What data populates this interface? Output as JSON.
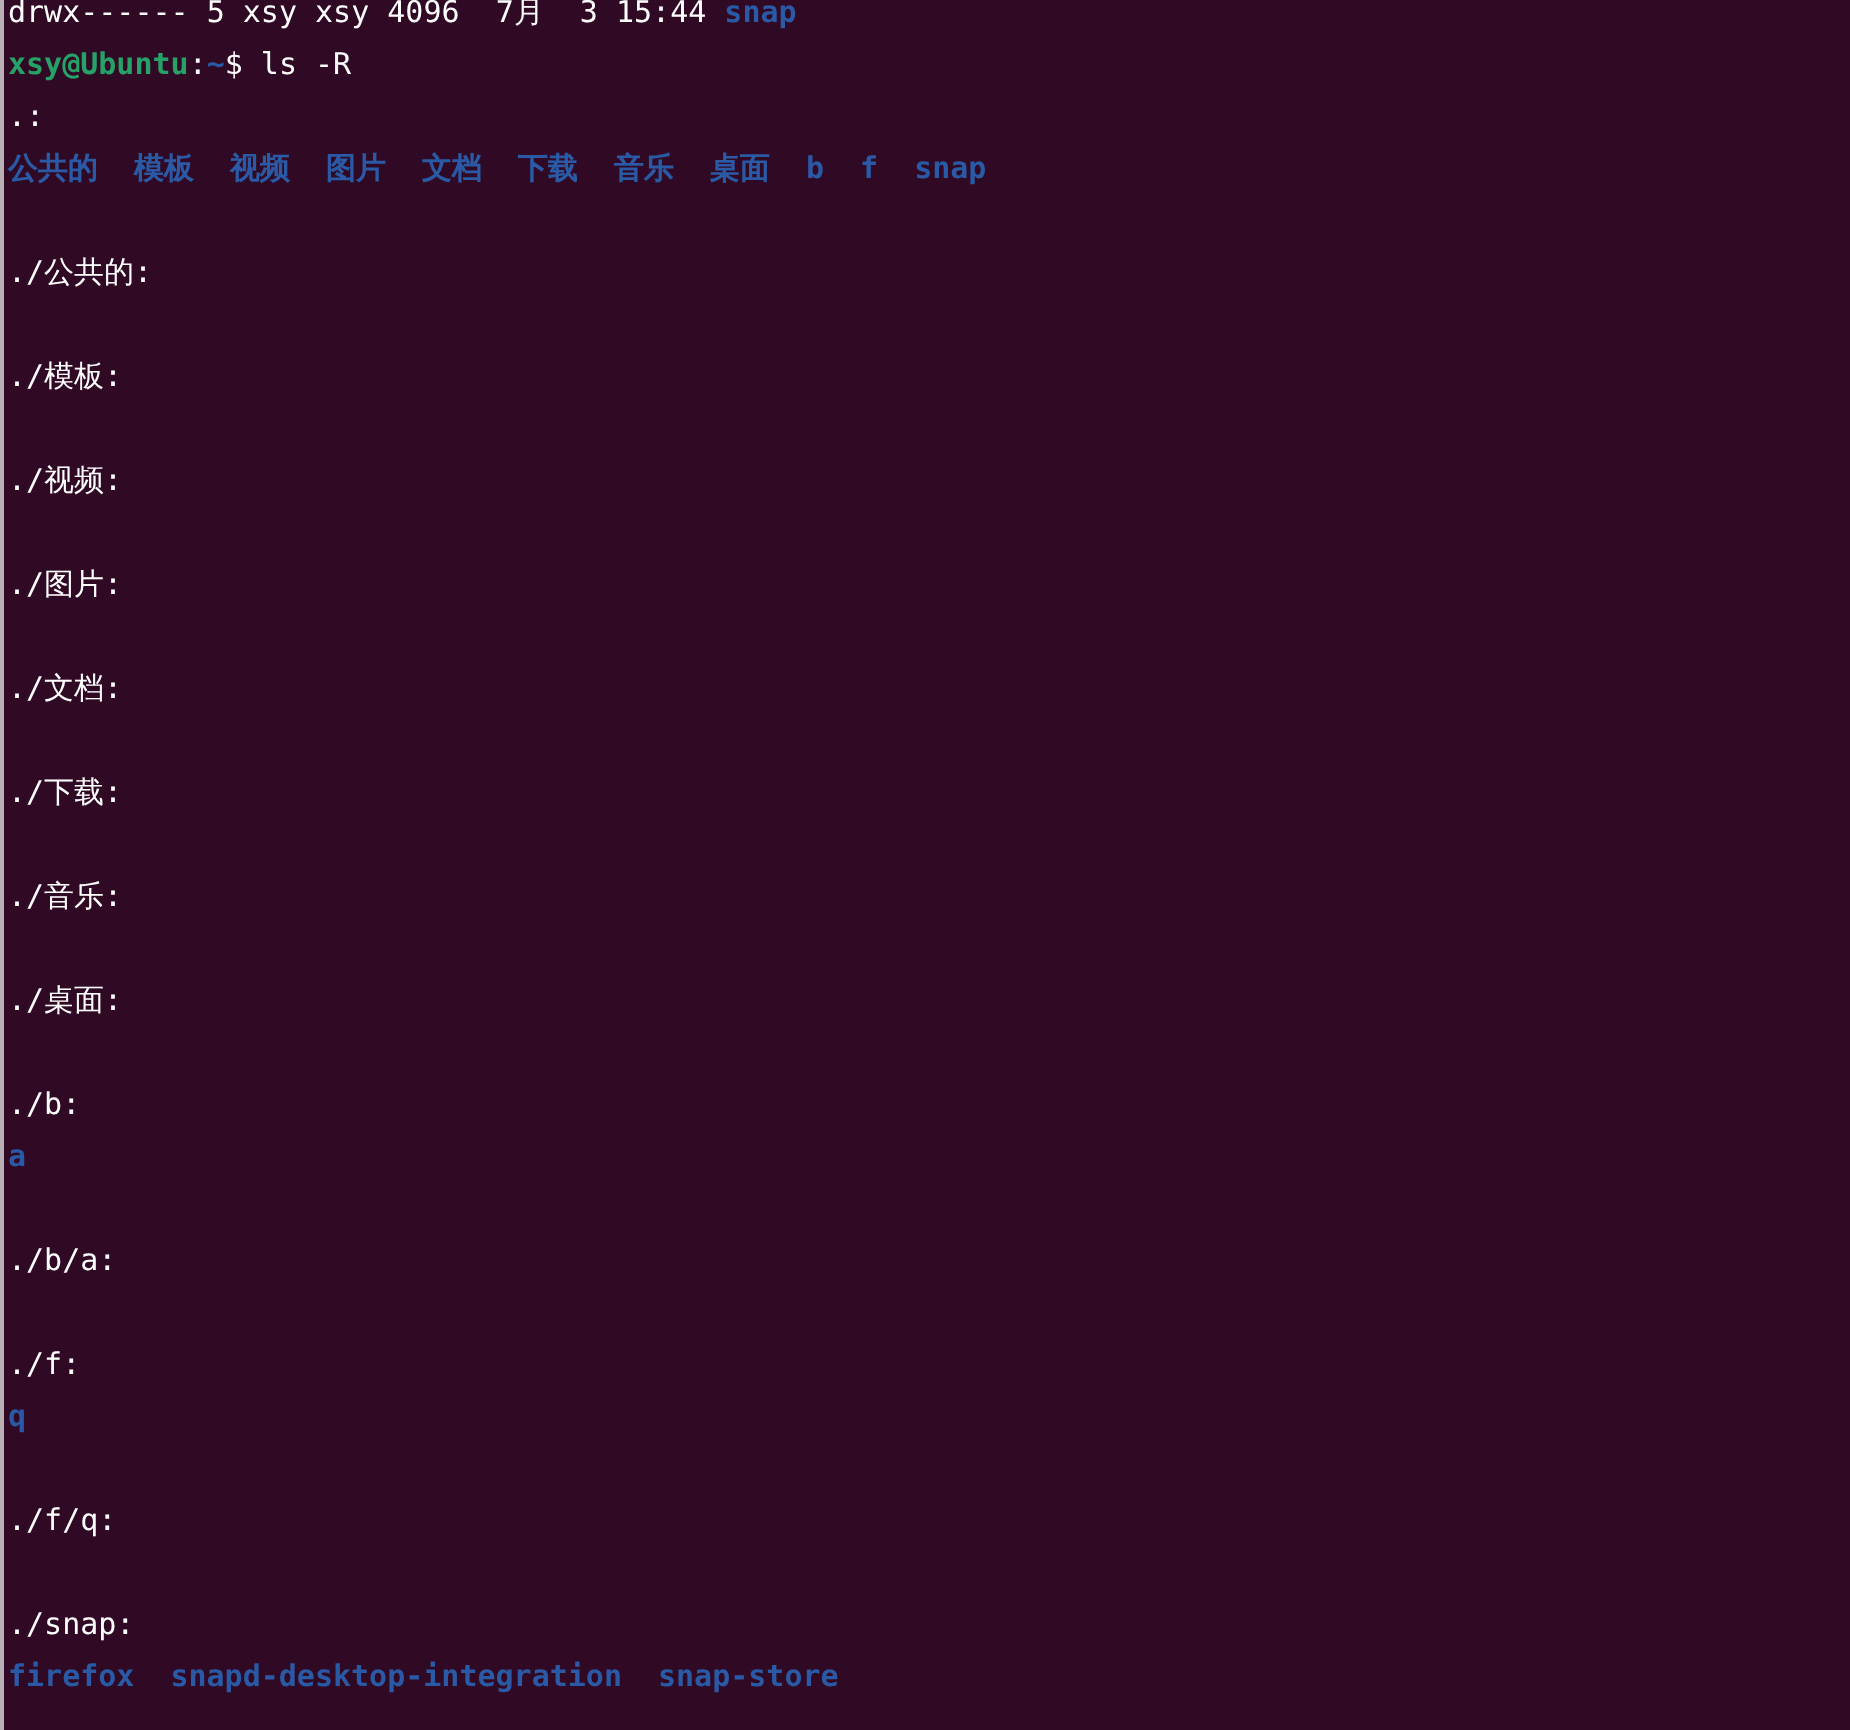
{
  "terminal": {
    "lines": [
      {
        "kind": "text",
        "segments": [
          {
            "kind": "plain",
            "text": "drwx------ 5 xsy xsy 4096  7月  3 15:44 "
          },
          {
            "kind": "dir",
            "text": "snap"
          }
        ]
      },
      {
        "kind": "text",
        "segments": [
          {
            "kind": "user",
            "text": "xsy@Ubuntu"
          },
          {
            "kind": "plain",
            "text": ":"
          },
          {
            "kind": "path",
            "text": "~"
          },
          {
            "kind": "plain",
            "text": "$ ls -R"
          }
        ]
      },
      {
        "kind": "text",
        "segments": [
          {
            "kind": "plain",
            "text": ".:"
          }
        ]
      },
      {
        "kind": "text",
        "segments": [
          {
            "kind": "dir",
            "text": "公共的"
          },
          {
            "kind": "dir",
            "text": "模板"
          },
          {
            "kind": "dir",
            "text": "视频"
          },
          {
            "kind": "dir",
            "text": "图片"
          },
          {
            "kind": "dir",
            "text": "文档"
          },
          {
            "kind": "dir",
            "text": "下载"
          },
          {
            "kind": "dir",
            "text": "音乐"
          },
          {
            "kind": "dir",
            "text": "桌面"
          },
          {
            "kind": "dir",
            "text": "b"
          },
          {
            "kind": "dir",
            "text": "f"
          },
          {
            "kind": "dir",
            "text": "snap"
          }
        ]
      },
      {
        "kind": "blank"
      },
      {
        "kind": "text",
        "segments": [
          {
            "kind": "plain",
            "text": "./公共的:"
          }
        ]
      },
      {
        "kind": "blank"
      },
      {
        "kind": "text",
        "segments": [
          {
            "kind": "plain",
            "text": "./模板:"
          }
        ]
      },
      {
        "kind": "blank"
      },
      {
        "kind": "text",
        "segments": [
          {
            "kind": "plain",
            "text": "./视频:"
          }
        ]
      },
      {
        "kind": "blank"
      },
      {
        "kind": "text",
        "segments": [
          {
            "kind": "plain",
            "text": "./图片:"
          }
        ]
      },
      {
        "kind": "blank"
      },
      {
        "kind": "text",
        "segments": [
          {
            "kind": "plain",
            "text": "./文档:"
          }
        ]
      },
      {
        "kind": "blank"
      },
      {
        "kind": "text",
        "segments": [
          {
            "kind": "plain",
            "text": "./下载:"
          }
        ]
      },
      {
        "kind": "blank"
      },
      {
        "kind": "text",
        "segments": [
          {
            "kind": "plain",
            "text": "./音乐:"
          }
        ]
      },
      {
        "kind": "blank"
      },
      {
        "kind": "text",
        "segments": [
          {
            "kind": "plain",
            "text": "./桌面:"
          }
        ]
      },
      {
        "kind": "blank"
      },
      {
        "kind": "text",
        "segments": [
          {
            "kind": "plain",
            "text": "./b:"
          }
        ]
      },
      {
        "kind": "text",
        "segments": [
          {
            "kind": "dir",
            "text": "a"
          }
        ]
      },
      {
        "kind": "blank"
      },
      {
        "kind": "text",
        "segments": [
          {
            "kind": "plain",
            "text": "./b/a:"
          }
        ]
      },
      {
        "kind": "blank"
      },
      {
        "kind": "text",
        "segments": [
          {
            "kind": "plain",
            "text": "./f:"
          }
        ]
      },
      {
        "kind": "text",
        "segments": [
          {
            "kind": "dir",
            "text": "q"
          }
        ]
      },
      {
        "kind": "blank"
      },
      {
        "kind": "text",
        "segments": [
          {
            "kind": "plain",
            "text": "./f/q:"
          }
        ]
      },
      {
        "kind": "blank"
      },
      {
        "kind": "text",
        "segments": [
          {
            "kind": "plain",
            "text": "./snap:"
          }
        ]
      },
      {
        "kind": "text",
        "segments": [
          {
            "kind": "dir",
            "text": "firefox"
          },
          {
            "kind": "dir",
            "text": "snapd-desktop-integration"
          },
          {
            "kind": "dir",
            "text": "snap-store"
          }
        ]
      }
    ]
  }
}
